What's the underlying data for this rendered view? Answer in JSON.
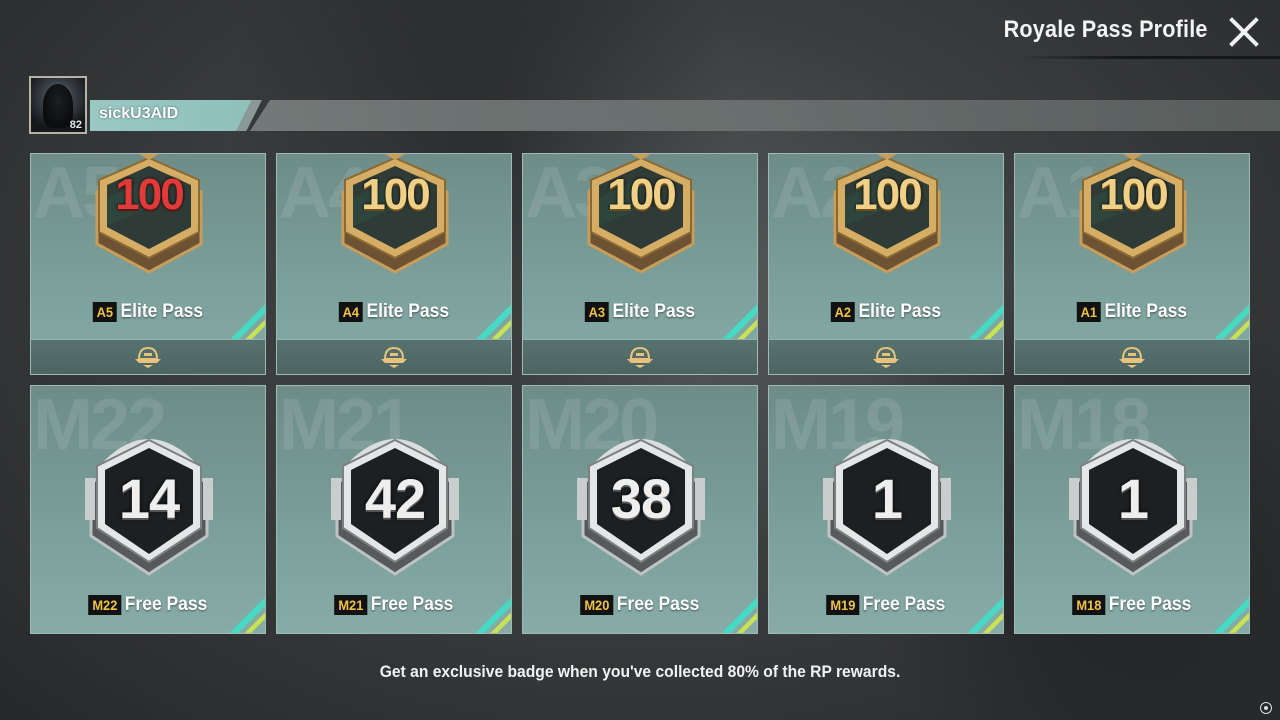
{
  "header": {
    "title": "Royale Pass Profile"
  },
  "profile": {
    "name": "sickU3AID",
    "level": "82"
  },
  "elite_cards": [
    {
      "tag": "A5",
      "label": "Elite Pass",
      "level": "100",
      "watermark": "A5",
      "highlight": true
    },
    {
      "tag": "A4",
      "label": "Elite Pass",
      "level": "100",
      "watermark": "A4",
      "highlight": false
    },
    {
      "tag": "A3",
      "label": "Elite Pass",
      "level": "100",
      "watermark": "A3",
      "highlight": false
    },
    {
      "tag": "A2",
      "label": "Elite Pass",
      "level": "100",
      "watermark": "A2",
      "highlight": false
    },
    {
      "tag": "A1",
      "label": "Elite Pass",
      "level": "100",
      "watermark": "A1",
      "highlight": false
    }
  ],
  "free_cards": [
    {
      "tag": "M22",
      "label": "Free Pass",
      "level": "14",
      "watermark": "M22"
    },
    {
      "tag": "M21",
      "label": "Free Pass",
      "level": "42",
      "watermark": "M21"
    },
    {
      "tag": "M20",
      "label": "Free Pass",
      "level": "38",
      "watermark": "M20"
    },
    {
      "tag": "M19",
      "label": "Free Pass",
      "level": "1",
      "watermark": "M19"
    },
    {
      "tag": "M18",
      "label": "Free Pass",
      "level": "1",
      "watermark": "M18"
    }
  ],
  "footer": {
    "message": "Get an exclusive badge when you've collected 80% of the RP rewards."
  },
  "colors": {
    "card_teal": "#7a9e99",
    "gold": "#f0cf86",
    "season_tag": "#f2c33c"
  }
}
